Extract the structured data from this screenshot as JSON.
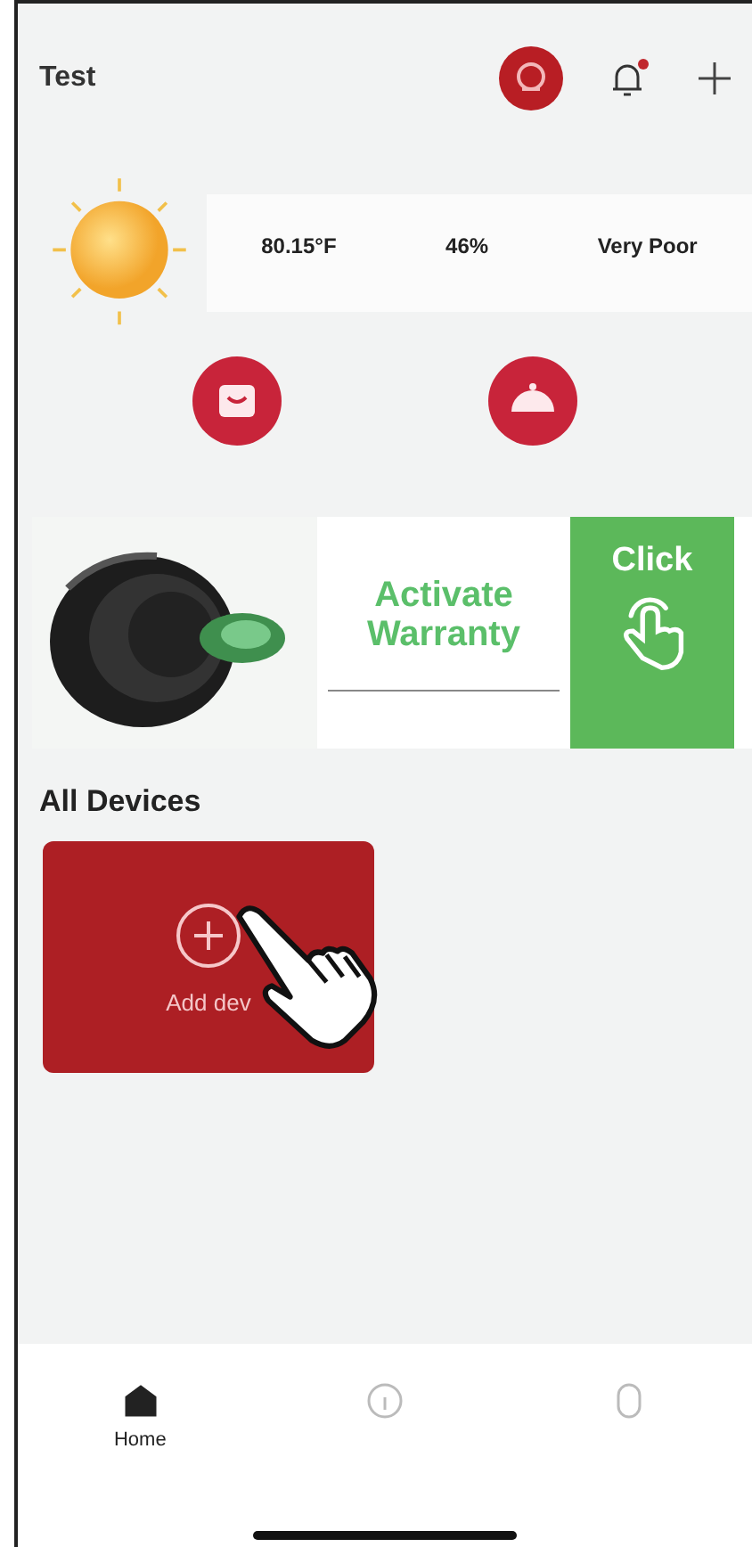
{
  "header": {
    "title": "Test",
    "notification_dot": true
  },
  "weather": {
    "readings": [
      {
        "value": "80.15°F"
      },
      {
        "value": "46%"
      },
      {
        "value": "Very Poor"
      }
    ]
  },
  "shortcuts": [
    {
      "kind": "mall"
    },
    {
      "kind": "menu"
    }
  ],
  "banner": {
    "title": "Activate Warranty",
    "button": "Click"
  },
  "section_title": "All Devices",
  "devices": [
    {
      "kind": "add",
      "label": "Add dev"
    }
  ],
  "tab_bar": [
    {
      "kind": "home",
      "label": "Home",
      "selected": true
    },
    {
      "kind": "info",
      "selected": false
    },
    {
      "kind": "profile",
      "selected": false
    }
  ]
}
